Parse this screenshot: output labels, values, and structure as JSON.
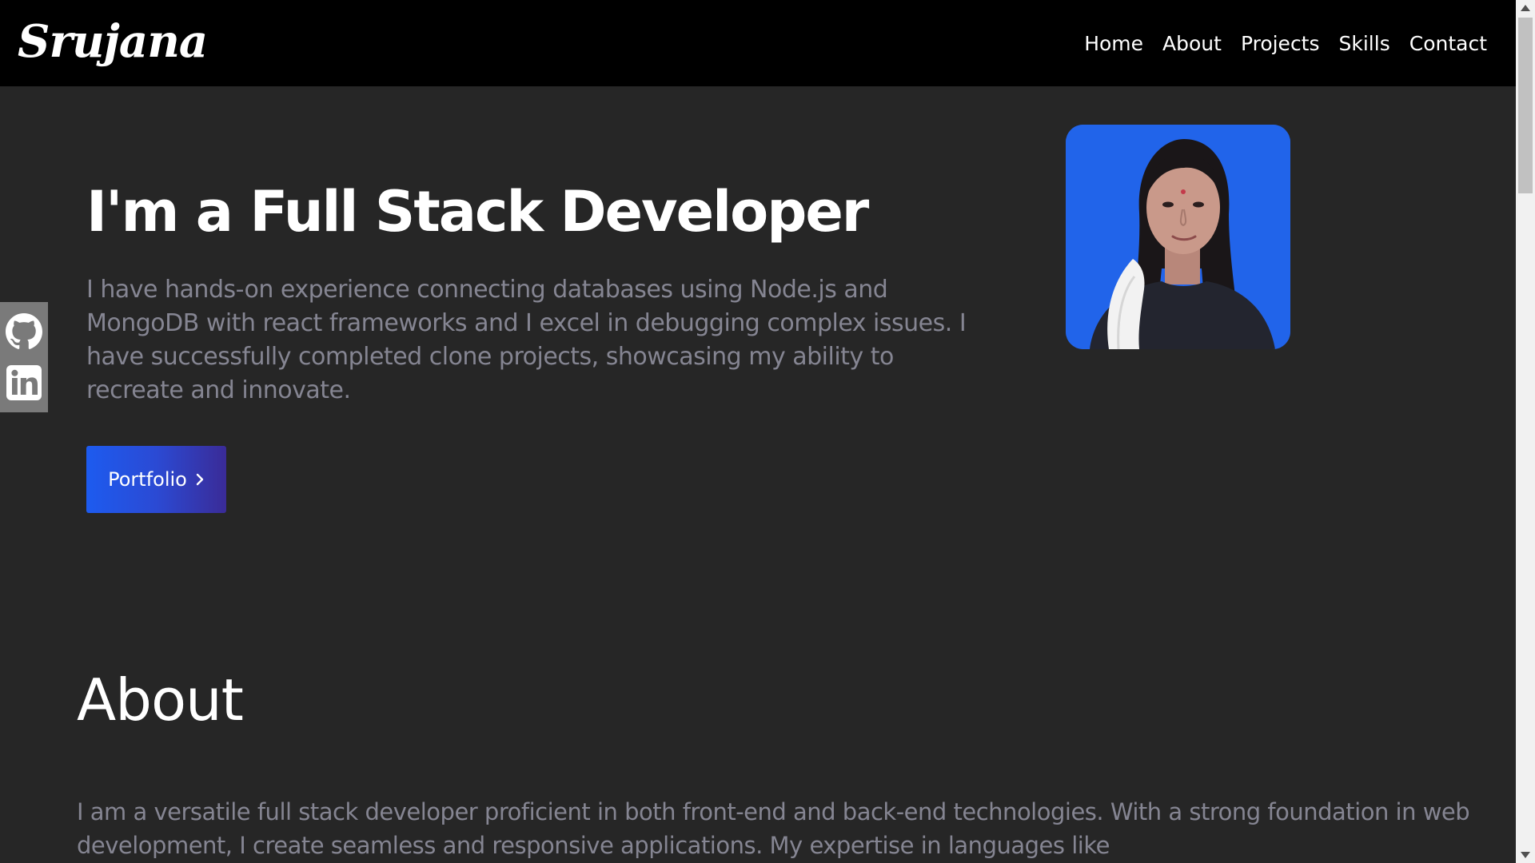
{
  "brand": {
    "logo_text": "Srujana"
  },
  "nav": {
    "items": [
      {
        "label": "Home"
      },
      {
        "label": "About"
      },
      {
        "label": "Projects"
      },
      {
        "label": "Skills"
      },
      {
        "label": "Contact"
      }
    ]
  },
  "social": {
    "icons": [
      "github-icon",
      "linkedin-icon"
    ]
  },
  "hero": {
    "title": "I'm a Full Stack Developer",
    "description": "I have hands-on experience connecting databases using Node.js and MongoDB with react frameworks and I excel in debugging complex issues. I have successfully completed clone projects, showcasing my ability to recreate and innovate.",
    "button_label": "Portfolio",
    "button_icon": "chevron-right-icon"
  },
  "about": {
    "heading": "About",
    "text": "I am a versatile full stack developer proficient in both front-end and back-end technologies. With a strong foundation in web development, I create seamless and responsive applications. My expertise in languages like"
  },
  "colors": {
    "header_bg": "#000000",
    "page_bg": "#262626",
    "muted_text": "#858592",
    "accent_start": "#1d5bef",
    "accent_end": "#3a2b97",
    "photo_bg": "#2164ea",
    "social_bg": "#7a7a7a"
  }
}
